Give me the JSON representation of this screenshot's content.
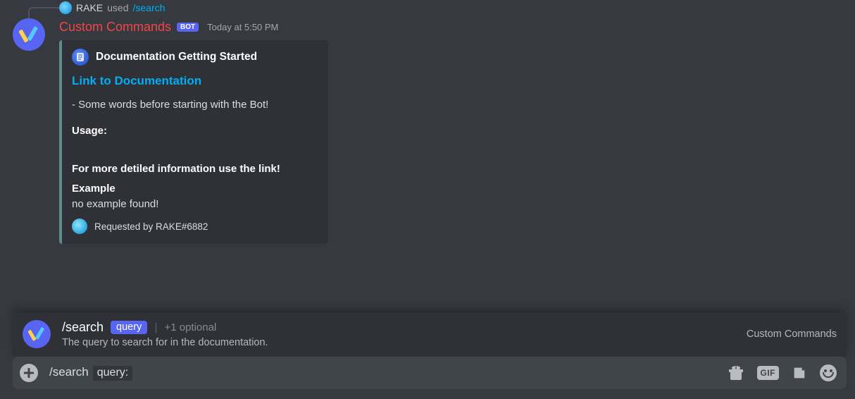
{
  "reply": {
    "user": "RAKE",
    "used_word": "used",
    "command": "/search"
  },
  "message": {
    "author": "Custom Commands",
    "bot_tag": "BOT",
    "timestamp": "Today at 5:50 PM"
  },
  "embed": {
    "author_name": "Documentation Getting Started",
    "title": "Link to Documentation",
    "description": "- Some words before starting with the Bot!",
    "usage_label": "Usage:",
    "more_info": "For more detiled information use the link!",
    "example_label": "Example",
    "example_body": "no example found!",
    "footer": "Requested by RAKE#6882"
  },
  "autocomplete": {
    "command": "/search",
    "param": "query",
    "optional": "+1 optional",
    "description": "The query to search for in the documentation.",
    "app_name": "Custom Commands"
  },
  "chatbar": {
    "command": "/search",
    "param": "query:",
    "gif_label": "GIF"
  }
}
